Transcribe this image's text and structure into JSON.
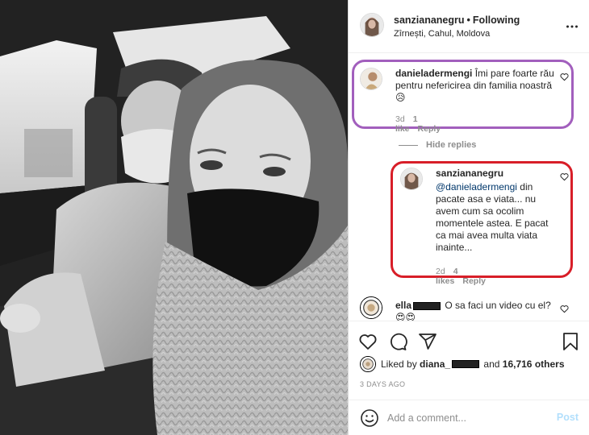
{
  "post": {
    "photo_alt": "Selfie of a woman in a black mask and knit scarf with an older man in a cap and mask, in a car (black and white)"
  },
  "header": {
    "username": "sanziananegru",
    "separator": "•",
    "follow_label": "Following",
    "location": "Zîrnești, Cahul, Moldova",
    "more_icon": "more-horizontal-icon"
  },
  "comments": [
    {
      "username": "danieladermengi",
      "text": "Îmi pare foarte rău pentru nefericirea din familia noastră 😥",
      "time": "3d",
      "likes": "1 like",
      "reply": "Reply",
      "highlight_color": "#a25fbd"
    }
  ],
  "hide_replies": "Hide replies",
  "reply": {
    "username": "sanziananegru",
    "mention": "@danieladermengi",
    "text": "din pacate asa e viata... nu avem cum sa ocolim momentele astea. E pacat ca mai avea multa viata inainte...",
    "time": "2d",
    "likes": "4 likes",
    "reply": "Reply",
    "highlight_color": "#d81e28"
  },
  "comment3": {
    "username": "ella",
    "text": "O sa faci un video cu el? 😍😍"
  },
  "actions": {
    "like_icon": "heart-icon",
    "comment_icon": "comment-icon",
    "share_icon": "share-icon",
    "save_icon": "bookmark-icon"
  },
  "liked_by": {
    "prefix": "Liked by",
    "user": "diana_",
    "middle": "and",
    "others": "16,716 others"
  },
  "date": "3 DAYS AGO",
  "add_comment": {
    "placeholder": "Add a comment...",
    "post_label": "Post",
    "post_color": "#b2dffc"
  }
}
